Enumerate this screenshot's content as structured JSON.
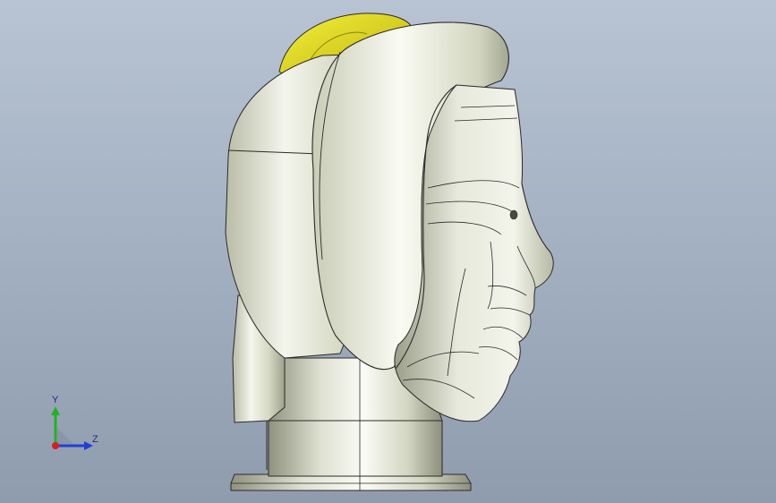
{
  "viewport": {
    "background_top": "#b8c4d3",
    "background_bottom": "#8f9cae"
  },
  "model": {
    "description_icon": "sculpted-head-model",
    "body_color": "#d9dcc8",
    "highlight_color": "#f3f4ea",
    "shadow_color": "#8f927e",
    "accent_color": "#e8e21a",
    "edge_color": "#2a2a2a"
  },
  "triad": {
    "y_label": "Y",
    "z_label": "Z",
    "y_color": "#1fb31f",
    "z_color": "#1f3fd6",
    "x_color": "#d61f1f"
  }
}
